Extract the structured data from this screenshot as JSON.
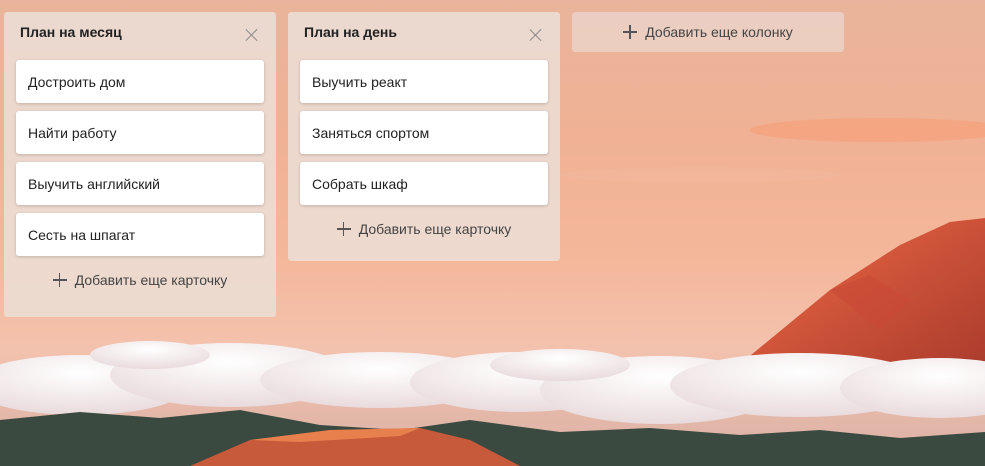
{
  "columns": [
    {
      "title": "План на месяц",
      "cards": [
        "Достроить дом",
        "Найти работу",
        "Выучить английский",
        "Сесть на шпагат"
      ],
      "add_card_label": "Добавить еще карточку"
    },
    {
      "title": "План на день",
      "cards": [
        "Выучить реакт",
        "Заняться спортом",
        "Собрать шкаф"
      ],
      "add_card_label": "Добавить еще карточку"
    }
  ],
  "add_column_label": "Добавить еще колонку",
  "icons": {
    "close": "close-icon",
    "add": "plus-icon"
  }
}
